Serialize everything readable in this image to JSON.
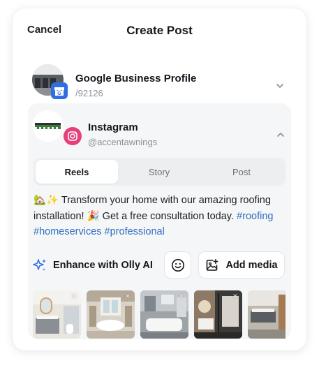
{
  "header": {
    "cancel_label": "Cancel",
    "title": "Create Post"
  },
  "accounts": [
    {
      "name": "Google Business Profile",
      "handle": "/92126",
      "badge_letter": "G",
      "badge_color": "#2f6fe4",
      "expanded": false
    },
    {
      "name": "Instagram",
      "handle": "@accentawnings",
      "badge_color": "#e4407a",
      "expanded": true
    }
  ],
  "tabs": [
    {
      "label": "Reels",
      "active": true
    },
    {
      "label": "Story",
      "active": false
    },
    {
      "label": "Post",
      "active": false
    }
  ],
  "caption": {
    "emoji_prefix": "🏡✨",
    "text_1": " Transform your home with our amazing roofing installation! ",
    "emoji_mid": "🎉",
    "text_2": " Get a free consultation today. ",
    "hashtags": [
      "#roofing",
      "#homeservices",
      "#professional"
    ]
  },
  "actions": {
    "enhance_label": "Enhance with Olly AI",
    "add_media_label": "Add media"
  },
  "media": [
    {
      "name": "bathroom-1",
      "remove_label": "×"
    },
    {
      "name": "bathroom-2",
      "remove_label": "×"
    },
    {
      "name": "bathroom-3",
      "remove_label": "×"
    },
    {
      "name": "bathroom-4",
      "remove_label": "×"
    },
    {
      "name": "bathroom-5",
      "remove_label": "×"
    }
  ],
  "colors": {
    "accent_blue": "#2e6fbf",
    "enhance_icon": "#2f6fe4",
    "instagram_badge": "#e4407a"
  }
}
